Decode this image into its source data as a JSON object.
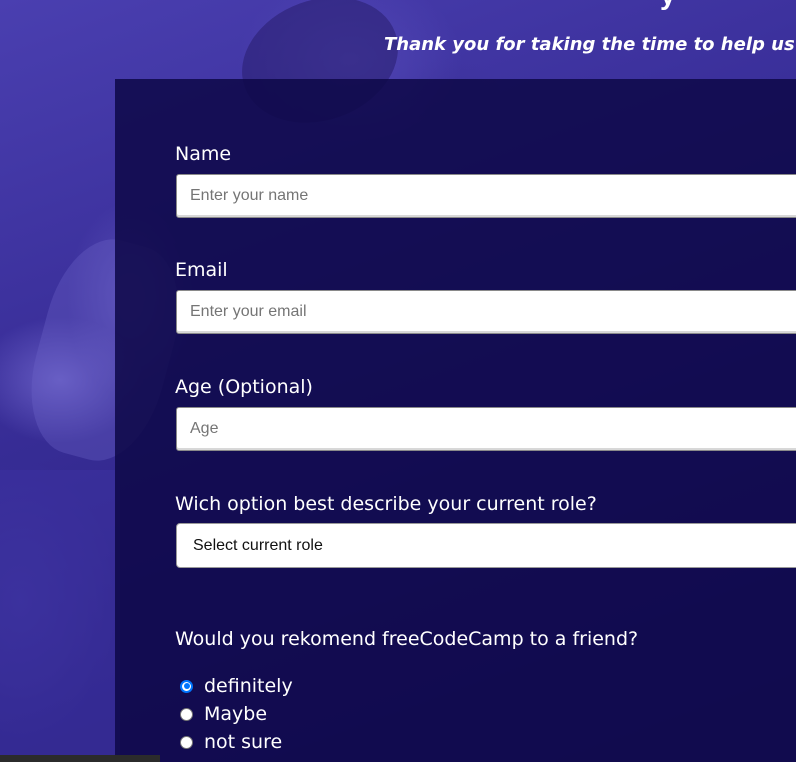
{
  "header": {
    "description": "Thank you for taking the time to help us impr",
    "title_remnant": "y"
  },
  "form": {
    "name": {
      "label": "Name",
      "placeholder": "Enter your name"
    },
    "email": {
      "label": "Email",
      "placeholder": "Enter your email"
    },
    "age": {
      "label": "Age (Optional)",
      "placeholder": "Age"
    },
    "role": {
      "label": "Wich option best describe your current role?",
      "selected": "Select current role"
    },
    "recommend": {
      "label": "Would you rekomend freeCodeCamp to a friend?",
      "options": [
        {
          "label": "definitely",
          "checked": true
        },
        {
          "label": "Maybe",
          "checked": false
        },
        {
          "label": "not sure",
          "checked": false
        }
      ]
    }
  },
  "colors": {
    "panel": "#0e0848",
    "background": "#3a2f9a",
    "radio_accent": "#0075ff"
  }
}
